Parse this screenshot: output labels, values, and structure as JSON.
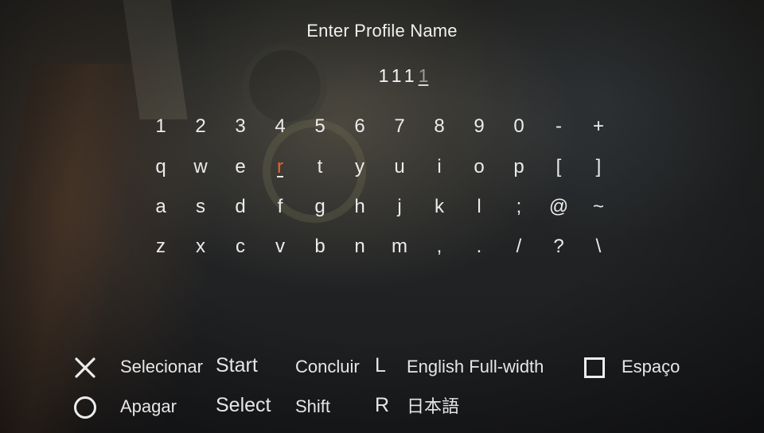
{
  "title": "Enter Profile Name",
  "name_field": {
    "typed": "111",
    "cursor_char": "1"
  },
  "keyboard": {
    "rows": [
      [
        "1",
        "2",
        "3",
        "4",
        "5",
        "6",
        "7",
        "8",
        "9",
        "0",
        "-",
        "+"
      ],
      [
        "q",
        "w",
        "e",
        "r",
        "t",
        "y",
        "u",
        "i",
        "o",
        "p",
        "[",
        "]"
      ],
      [
        "a",
        "s",
        "d",
        "f",
        "g",
        "h",
        "j",
        "k",
        "l",
        ";",
        "@",
        "~"
      ],
      [
        "z",
        "x",
        "c",
        "v",
        "b",
        "n",
        "m",
        ",",
        ".",
        "/",
        "?",
        "\\"
      ]
    ],
    "selected_key": "r"
  },
  "legend": {
    "cross": {
      "icon": "cross-button-icon",
      "label": "Selecionar"
    },
    "circle": {
      "icon": "circle-button-icon",
      "label": "Apagar"
    },
    "start": {
      "button": "Start",
      "label": "Concluir"
    },
    "select": {
      "button": "Select",
      "label": "Shift"
    },
    "l": {
      "button": "L",
      "label": "English Full-width"
    },
    "r": {
      "button": "R",
      "label": "日本語"
    },
    "square": {
      "icon": "square-button-icon",
      "label": "Espaço"
    }
  },
  "colors": {
    "selected_key": "#e8642c",
    "text": "#ececec"
  }
}
